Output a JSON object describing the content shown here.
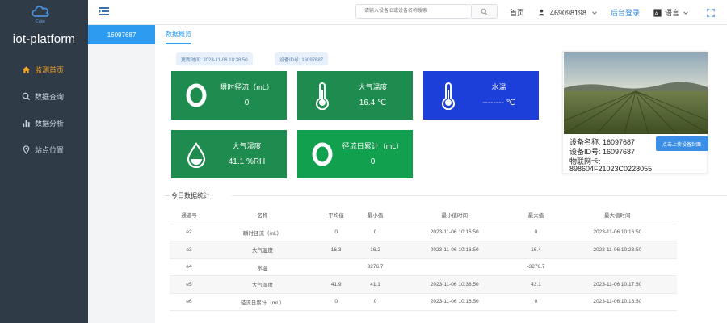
{
  "sidebar": {
    "logo_sub": "Cake",
    "brand": "iot-platform",
    "items": [
      {
        "label": "监测首页",
        "icon": "home-icon",
        "active": true
      },
      {
        "label": "数据查询",
        "icon": "search-icon",
        "active": false
      },
      {
        "label": "数据分析",
        "icon": "bar-chart-icon",
        "active": false
      },
      {
        "label": "站点位置",
        "icon": "location-pin-icon",
        "active": false
      }
    ]
  },
  "header": {
    "search_placeholder": "请输入设备ID或设备名称搜索",
    "home": "首页",
    "user": "469098198",
    "admin": "后台登录",
    "language": "语言"
  },
  "tabs": {
    "device": "16097687",
    "overview": "数据概览"
  },
  "info": {
    "update_time": "更新时间: 2023-11-06 10:38:50",
    "device_id": "设备ID号: 16097687"
  },
  "cards": [
    {
      "name": "瞬时径流（mL）",
      "value": "0",
      "icon": "ring-icon",
      "color": "#1d8c4e"
    },
    {
      "name": "大气温度",
      "value": "16.4 ℃",
      "icon": "thermometer-icon",
      "color": "#1d8c4e"
    },
    {
      "name": "水温",
      "value": "-------- ℃",
      "icon": "thermometer-icon",
      "color": "#1d3fd9"
    },
    {
      "name": "大气湿度",
      "value": "41.1 %RH",
      "icon": "water-drop-icon",
      "color": "#1d8c4e"
    },
    {
      "name": "径流日累计（mL）",
      "value": "0",
      "icon": "ring-icon",
      "color": "#11a04e"
    }
  ],
  "device": {
    "name": "设备名称: 16097687",
    "id": "设备ID号: 16097687",
    "sim_label": "物联网卡:",
    "sim_value": "898604F21023C0228055",
    "upload": "点击上传设备封面"
  },
  "stats": {
    "title": "今日数据统计",
    "columns": [
      "通道号",
      "名称",
      "平均值",
      "最小值",
      "最小值时间",
      "最大值",
      "最大值时间"
    ],
    "rows": [
      [
        "e2",
        "瞬时径流（mL）",
        "0",
        "0",
        "2023-11-06 10:16:50",
        "0",
        "2023-11-06 10:16:50"
      ],
      [
        "e3",
        "大气温度",
        "16.3",
        "16.2",
        "2023-11-06 10:16:50",
        "16.4",
        "2023-11-06 10:23:50"
      ],
      [
        "e4",
        "水温",
        "",
        "3276.7",
        "",
        "-3276.7",
        ""
      ],
      [
        "e5",
        "大气湿度",
        "41.9",
        "41.1",
        "2023-11-06 10:38:50",
        "43.1",
        "2023-11-06 10:17:50"
      ],
      [
        "e6",
        "径流日累计（mL）",
        "0",
        "0",
        "2023-11-06 10:16:50",
        "0",
        "2023-11-06 10:16:50"
      ]
    ]
  }
}
